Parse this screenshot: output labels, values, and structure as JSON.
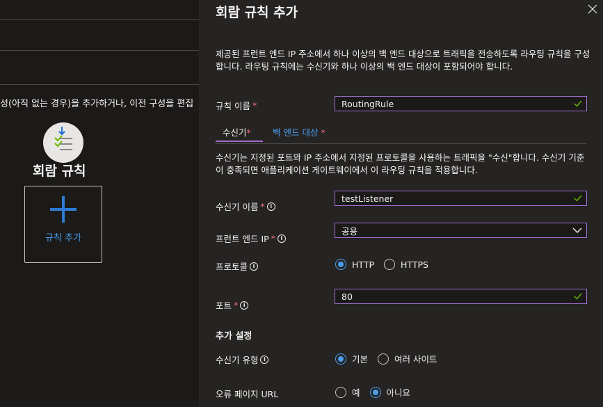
{
  "background": {
    "truncated_text": "성(아직 없는 경우)을 추가하거나, 이전 구성을 편집",
    "rules_title": "회람 규칙",
    "add_rule_label": "규칙 추가"
  },
  "panel": {
    "title": "회람 규칙 추가",
    "description": "제공된 프런트 엔드 IP 주소에서 하나 이상의 백 엔드 대상으로 트래픽을 전송하도록 라우팅 규칙을 구성합니다. 라우팅 규칙에는 수신기와 하나 이상의 백 엔드 대상이 포함되어야 합니다.",
    "rule_name_label": "규칙 이름",
    "rule_name_value": "RoutingRule",
    "tabs": [
      {
        "label": "수신기"
      },
      {
        "label": "백 엔드 대상"
      }
    ],
    "listener_description": "수신기는 지정된 포트와 IP 주소에서 지정된 프로토콜을 사용하는 트래픽을 \"수신\"합니다. 수신기 기준이 충족되면 애플리케이션 게이트웨이에서 이 라우팅 규칙을 적용합니다.",
    "listener_name_label": "수신기 이름",
    "listener_name_value": "testListener",
    "frontend_ip_label": "프런트 엔드 IP",
    "frontend_ip_value": "공용",
    "protocol_label": "프로토콜",
    "protocol_options": [
      "HTTP",
      "HTTPS"
    ],
    "protocol_selected": "HTTP",
    "port_label": "포트",
    "port_value": "80",
    "additional_settings_title": "추가 설정",
    "listener_type_label": "수신기 유형",
    "listener_type_options": [
      "기본",
      "여러 사이트"
    ],
    "listener_type_selected": "기본",
    "error_page_label": "오류 페이지 URL",
    "error_page_options": [
      "예",
      "아니요"
    ],
    "error_page_selected": "아니요",
    "required_mark": "*",
    "info_glyph": "i"
  },
  "colors": {
    "accent_purple": "#a26fd0",
    "link_blue": "#4aa0f0",
    "required_red": "#f1707b",
    "valid_green": "#6bb700"
  }
}
